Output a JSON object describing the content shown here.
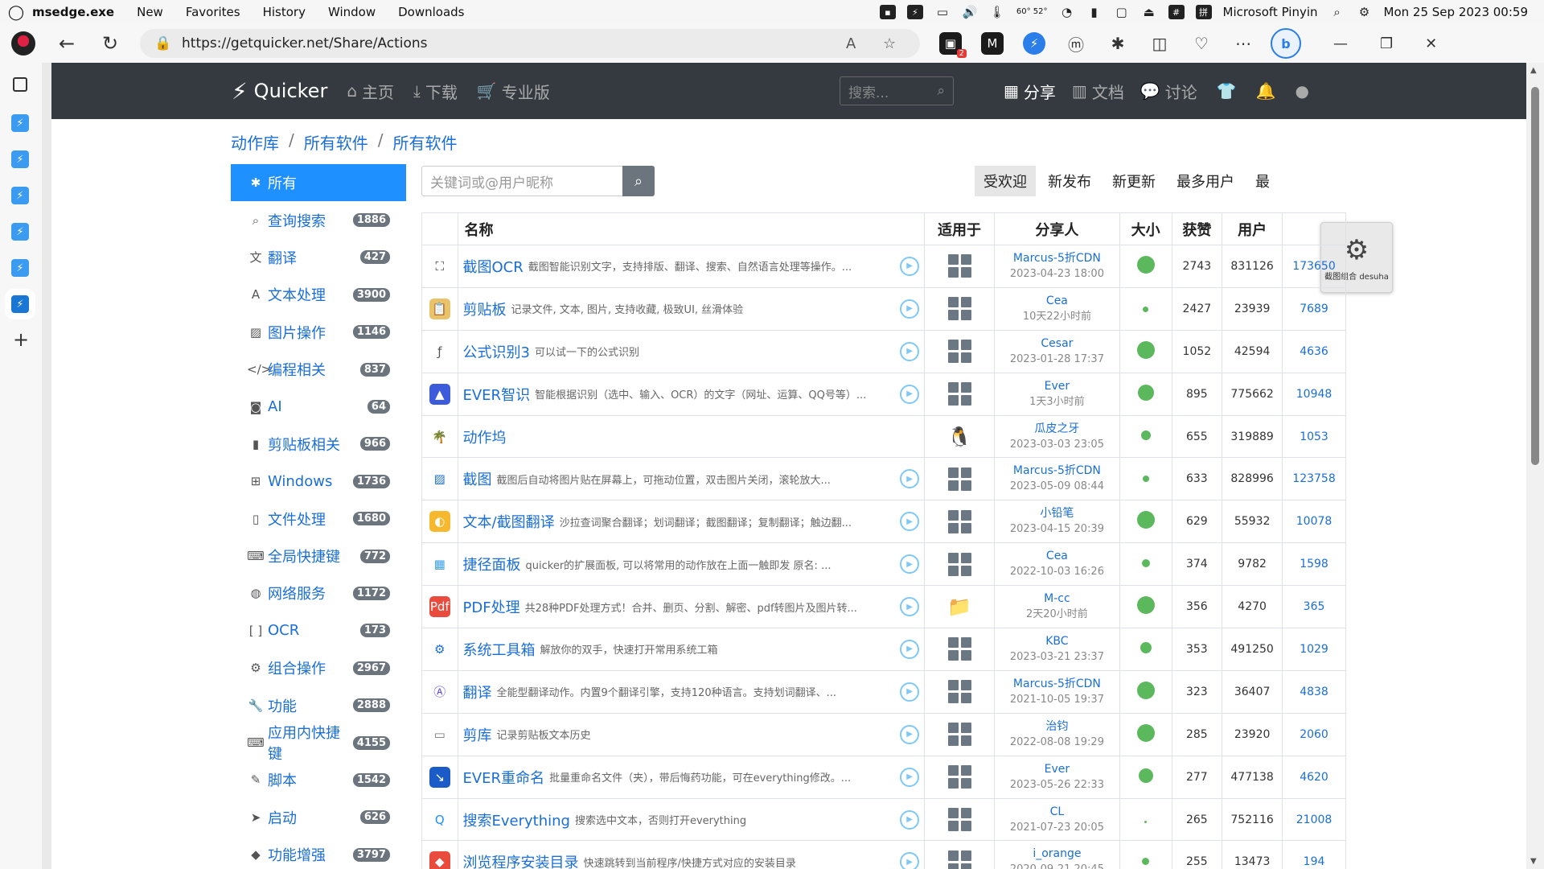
{
  "menubar": {
    "app_name": "msedge.exe",
    "items": [
      "New",
      "Favorites",
      "History",
      "Window",
      "Downloads"
    ],
    "temp": "60°\n52°",
    "input_method": "Microsoft Pinyin",
    "datetime": "Mon 25 Sep 2023 00:59"
  },
  "browser": {
    "url": "https://getquicker.net/Share/Actions",
    "badge": "2",
    "bing_label": "b"
  },
  "site": {
    "brand": "Quicker",
    "nav": [
      {
        "label": "主页",
        "icon": "home-icon"
      },
      {
        "label": "下载",
        "icon": "download-icon"
      },
      {
        "label": "专业版",
        "icon": "cart-icon"
      }
    ],
    "search_placeholder": "搜索...",
    "right_nav": [
      {
        "label": "分享",
        "icon": "grid-icon"
      },
      {
        "label": "文档",
        "icon": "books-icon"
      },
      {
        "label": "讨论",
        "icon": "comments-icon"
      }
    ]
  },
  "breadcrumb": [
    "动作库",
    "所有软件",
    "所有软件"
  ],
  "categories": [
    {
      "label": "所有",
      "count": "",
      "icon": "asterisk-icon",
      "active": true
    },
    {
      "label": "查询搜索",
      "count": "1886",
      "icon": "search-icon"
    },
    {
      "label": "翻译",
      "count": "427",
      "icon": "translate-icon"
    },
    {
      "label": "文本处理",
      "count": "3900",
      "icon": "font-icon"
    },
    {
      "label": "图片操作",
      "count": "1146",
      "icon": "image-icon"
    },
    {
      "label": "编程相关",
      "count": "837",
      "icon": "code-icon"
    },
    {
      "label": "AI",
      "count": "64",
      "icon": "robot-icon"
    },
    {
      "label": "剪贴板相关",
      "count": "966",
      "icon": "clipboard-icon"
    },
    {
      "label": "Windows",
      "count": "1736",
      "icon": "windows-icon"
    },
    {
      "label": "文件处理",
      "count": "1680",
      "icon": "file-icon"
    },
    {
      "label": "全局快捷键",
      "count": "772",
      "icon": "keyboard-icon"
    },
    {
      "label": "网络服务",
      "count": "1172",
      "icon": "globe-icon"
    },
    {
      "label": "OCR",
      "count": "173",
      "icon": "scan-icon"
    },
    {
      "label": "组合操作",
      "count": "2967",
      "icon": "cogs-icon"
    },
    {
      "label": "功能",
      "count": "2888",
      "icon": "wrench-icon"
    },
    {
      "label": "应用内快捷键",
      "count": "4155",
      "icon": "keyboard-icon"
    },
    {
      "label": "脚本",
      "count": "1542",
      "icon": "script-icon"
    },
    {
      "label": "启动",
      "count": "626",
      "icon": "paper-plane-icon"
    },
    {
      "label": "功能增强",
      "count": "3797",
      "icon": "cubes-icon"
    }
  ],
  "search": {
    "placeholder": "关键词或@用户昵称"
  },
  "sort_tabs": [
    "受欢迎",
    "新发布",
    "新更新",
    "最多用户",
    "最"
  ],
  "popup": {
    "label": "截图组合 desuha"
  },
  "table_headers": [
    "名称",
    "适用于",
    "分享人",
    "大小",
    "获赞",
    "用户"
  ],
  "actions": [
    {
      "title": "截图OCR",
      "desc": "截图智能识别文字，支持排版、翻译、搜索、自然语言处理等操作。...",
      "icon": "ocr-icon",
      "icon_color": "#ffffff",
      "icon_fg": "#333333",
      "app": "grid",
      "sharer": "Marcus-5折CDN",
      "time": "2023-04-23 18:00",
      "dot": 22,
      "likes": "2743",
      "users": "831126",
      "link": "173650",
      "play": true
    },
    {
      "title": "剪贴板",
      "desc": "记录文件, 文本, 图片, 支持收藏, 极致UI, 丝滑体验",
      "icon": "clipboard-icon",
      "icon_color": "#e8c36a",
      "icon_fg": "#ffffff",
      "app": "grid",
      "sharer": "Cea",
      "time": "10天22小时前",
      "dot": 7,
      "likes": "2427",
      "users": "23939",
      "link": "7689",
      "play": true
    },
    {
      "title": "公式识别3",
      "desc": "可以试一下的公式识别",
      "icon": "formula-icon",
      "icon_color": "#ffffff",
      "icon_fg": "#555555",
      "app": "grid",
      "sharer": "Cesar",
      "time": "2023-01-28 17:37",
      "dot": 22,
      "likes": "1052",
      "users": "42594",
      "link": "4636",
      "play": true
    },
    {
      "title": "EVER智识",
      "desc": "智能根据识别（选中、输入、OCR）的文字（网址、运算、QQ号等）...",
      "icon": "ever-icon",
      "icon_color": "#3b5bdb",
      "icon_fg": "#ffffff",
      "app": "grid",
      "sharer": "Ever",
      "time": "1天3小时前",
      "dot": 20,
      "likes": "895",
      "users": "775662",
      "link": "10948",
      "play": true
    },
    {
      "title": "动作坞",
      "desc": "",
      "icon": "palm-icon",
      "icon_color": "#ffffff",
      "icon_fg": "#2ea84a",
      "app": "qq",
      "sharer": "瓜皮之牙",
      "time": "2023-03-03 23:05",
      "dot": 12,
      "likes": "655",
      "users": "319889",
      "link": "1053",
      "play": false
    },
    {
      "title": "截图",
      "desc": "截图后自动将图片贴在屏幕上，可拖动位置，双击图片关闭，滚轮放大...",
      "icon": "picture-icon",
      "icon_color": "#ffffff",
      "icon_fg": "#1a6ed8",
      "app": "grid",
      "sharer": "Marcus-5折CDN",
      "time": "2023-05-09 08:44",
      "dot": 8,
      "likes": "633",
      "users": "828996",
      "link": "123758",
      "play": true
    },
    {
      "title": "文本/截图翻译",
      "desc": "沙拉查词聚合翻译；划词翻译；截图翻译；复制翻译；触边翻...",
      "icon": "salad-icon",
      "icon_color": "#f5b82e",
      "icon_fg": "#ffffff",
      "app": "grid",
      "sharer": "小铅笔",
      "time": "2023-04-15 20:39",
      "dot": 22,
      "likes": "629",
      "users": "55932",
      "link": "10078",
      "play": true
    },
    {
      "title": "捷径面板",
      "desc": "quicker的扩展面板, 可以将常用的动作放在上面一触即发 原名: ...",
      "icon": "panel-icon",
      "icon_color": "#ffffff",
      "icon_fg": "#3aa0e8",
      "app": "grid",
      "sharer": "Cea",
      "time": "2022-10-03 16:26",
      "dot": 10,
      "likes": "374",
      "users": "9782",
      "link": "1598",
      "play": true
    },
    {
      "title": "PDF处理",
      "desc": "共28种PDF处理方式！合并、删页、分割、解密、pdf转图片及图片转...",
      "icon": "pdf-icon",
      "icon_color": "#e94b3c",
      "icon_fg": "#ffffff",
      "app": "folder",
      "sharer": "M-cc",
      "time": "2天20小时前",
      "dot": 22,
      "likes": "356",
      "users": "4270",
      "link": "365",
      "play": true
    },
    {
      "title": "系统工具箱",
      "desc": "解放你的双手，快速打开常用系统工箱",
      "icon": "gear-icon",
      "icon_color": "#ffffff",
      "icon_fg": "#1a6ed8",
      "app": "grid",
      "sharer": "KBC",
      "time": "2023-03-21 23:37",
      "dot": 14,
      "likes": "353",
      "users": "491250",
      "link": "1029",
      "play": true
    },
    {
      "title": "翻译",
      "desc": "全能型翻译动作。内置9个翻译引擎，支持120种语言。支持划词翻译、...",
      "icon": "translate-a-icon",
      "icon_color": "#ffffff",
      "icon_fg": "#5b4bdb",
      "app": "grid",
      "sharer": "Marcus-5折CDN",
      "time": "2021-10-05 19:37",
      "dot": 22,
      "likes": "323",
      "users": "36407",
      "link": "4838",
      "play": true
    },
    {
      "title": "剪库",
      "desc": "记录剪贴板文本历史",
      "icon": "inbox-icon",
      "icon_color": "#ffffff",
      "icon_fg": "#777777",
      "app": "grid",
      "sharer": "治钧",
      "time": "2022-08-08 19:29",
      "dot": 22,
      "likes": "285",
      "users": "23920",
      "link": "2060",
      "play": true
    },
    {
      "title": "EVER重命名",
      "desc": "批量重命名文件（夹），带后悔药功能，可在everything修改。...",
      "icon": "rename-icon",
      "icon_color": "#1a5bc8",
      "icon_fg": "#ffffff",
      "app": "grid",
      "sharer": "Ever",
      "time": "2023-05-26 22:33",
      "dot": 18,
      "likes": "277",
      "users": "477138",
      "link": "4620",
      "play": true
    },
    {
      "title": "搜索Everything",
      "desc": "搜索选中文本，否则打开everything",
      "icon": "everything-icon",
      "icon_color": "#ffffff",
      "icon_fg": "#1e90ff",
      "app": "grid",
      "sharer": "CL",
      "time": "2021-07-23 20:05",
      "dot": 3,
      "likes": "265",
      "users": "752116",
      "link": "21008",
      "play": true
    },
    {
      "title": "浏览程序安装目录",
      "desc": "快速跳转到当前程序/快捷方式对应的安装目录",
      "icon": "box-icon",
      "icon_color": "#e94b3c",
      "icon_fg": "#ffffff",
      "app": "grid",
      "sharer": "i_orange",
      "time": "2020-09-21 20:45",
      "dot": 9,
      "likes": "255",
      "users": "13473",
      "link": "194",
      "play": true
    }
  ]
}
